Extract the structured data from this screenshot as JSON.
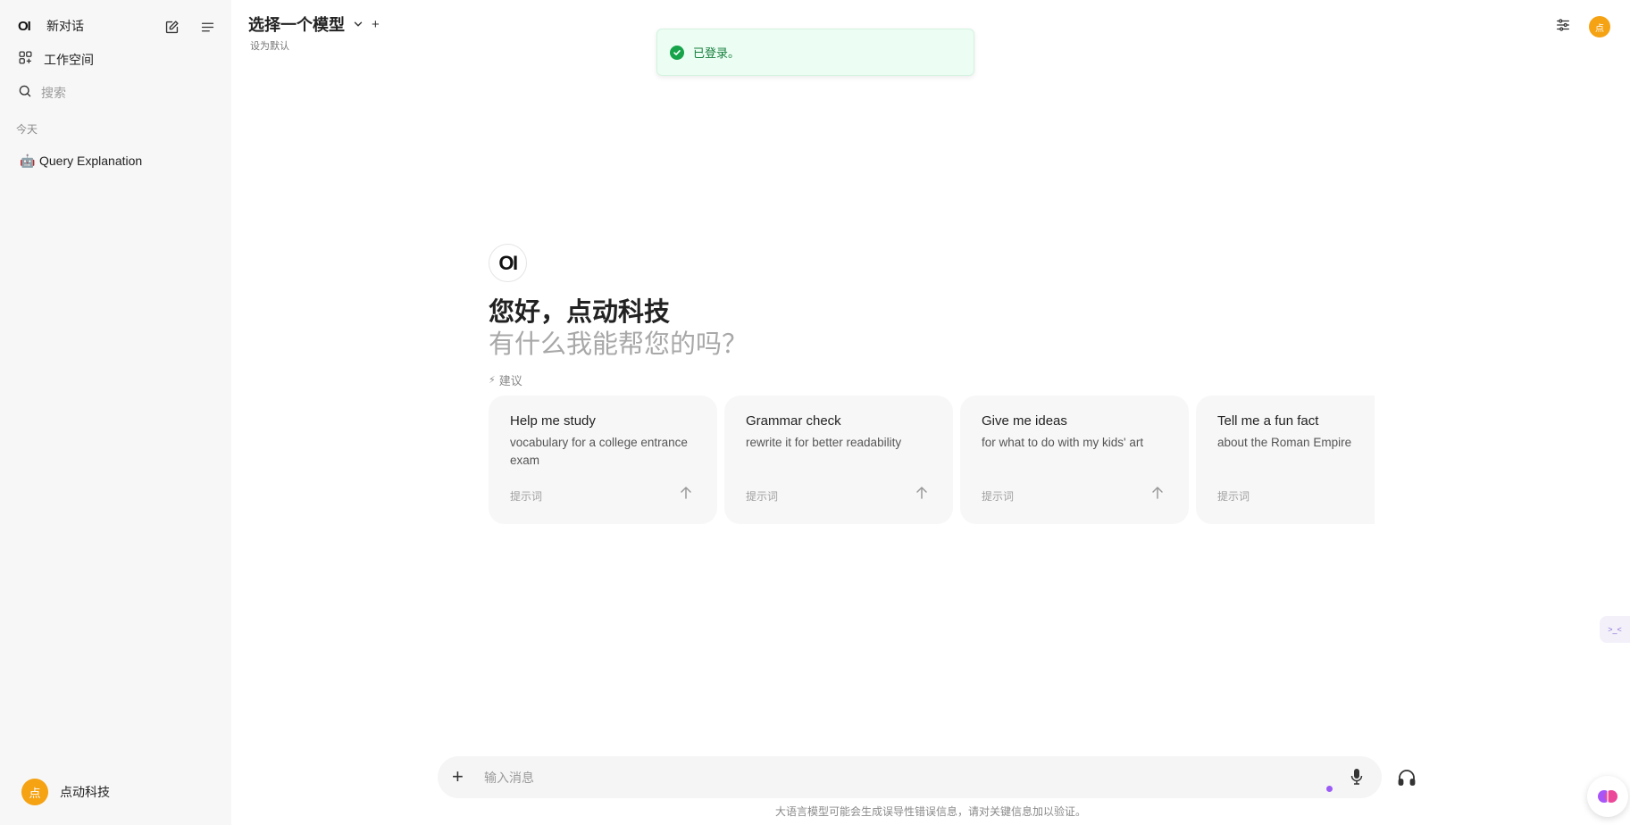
{
  "sidebar": {
    "logo": "OI",
    "new_chat": "新对话",
    "workspace": "工作空间",
    "search_placeholder": "搜索",
    "section_today": "今天",
    "chats": [
      {
        "emoji": "🤖",
        "title": "Query Explanation"
      }
    ],
    "user": {
      "avatar": "点",
      "name": "点动科技"
    }
  },
  "header": {
    "model_select": "选择一个模型",
    "add_model": "+",
    "set_default": "设为默认",
    "user_avatar": "点"
  },
  "toast": {
    "message": "已登录。",
    "type": "success"
  },
  "main": {
    "logo": "OI",
    "greeting": "您好，点动科技",
    "subtitle": "有什么我能帮您的吗？",
    "suggestions_label": "建议",
    "suggestions": [
      {
        "title": "Help me study",
        "description": "vocabulary for a college entrance exam",
        "hint": "提示词"
      },
      {
        "title": "Grammar check",
        "description": "rewrite it for better readability",
        "hint": "提示词"
      },
      {
        "title": "Give me ideas",
        "description": "for what to do with my kids' art",
        "hint": "提示词"
      },
      {
        "title": "Tell me a fun fact",
        "description": "about the Roman Empire",
        "hint": "提示词"
      }
    ]
  },
  "input": {
    "placeholder": "输入消息",
    "disclaimer": "大语言模型可能会生成误导性错误信息，请对关键信息加以验证。"
  },
  "colors": {
    "accent_avatar": "#f5a213",
    "toast_bg": "#ecfdf3",
    "toast_text": "#15803d",
    "sidebar_bg": "#f7f7f7",
    "card_bg": "#f7f7f7"
  }
}
